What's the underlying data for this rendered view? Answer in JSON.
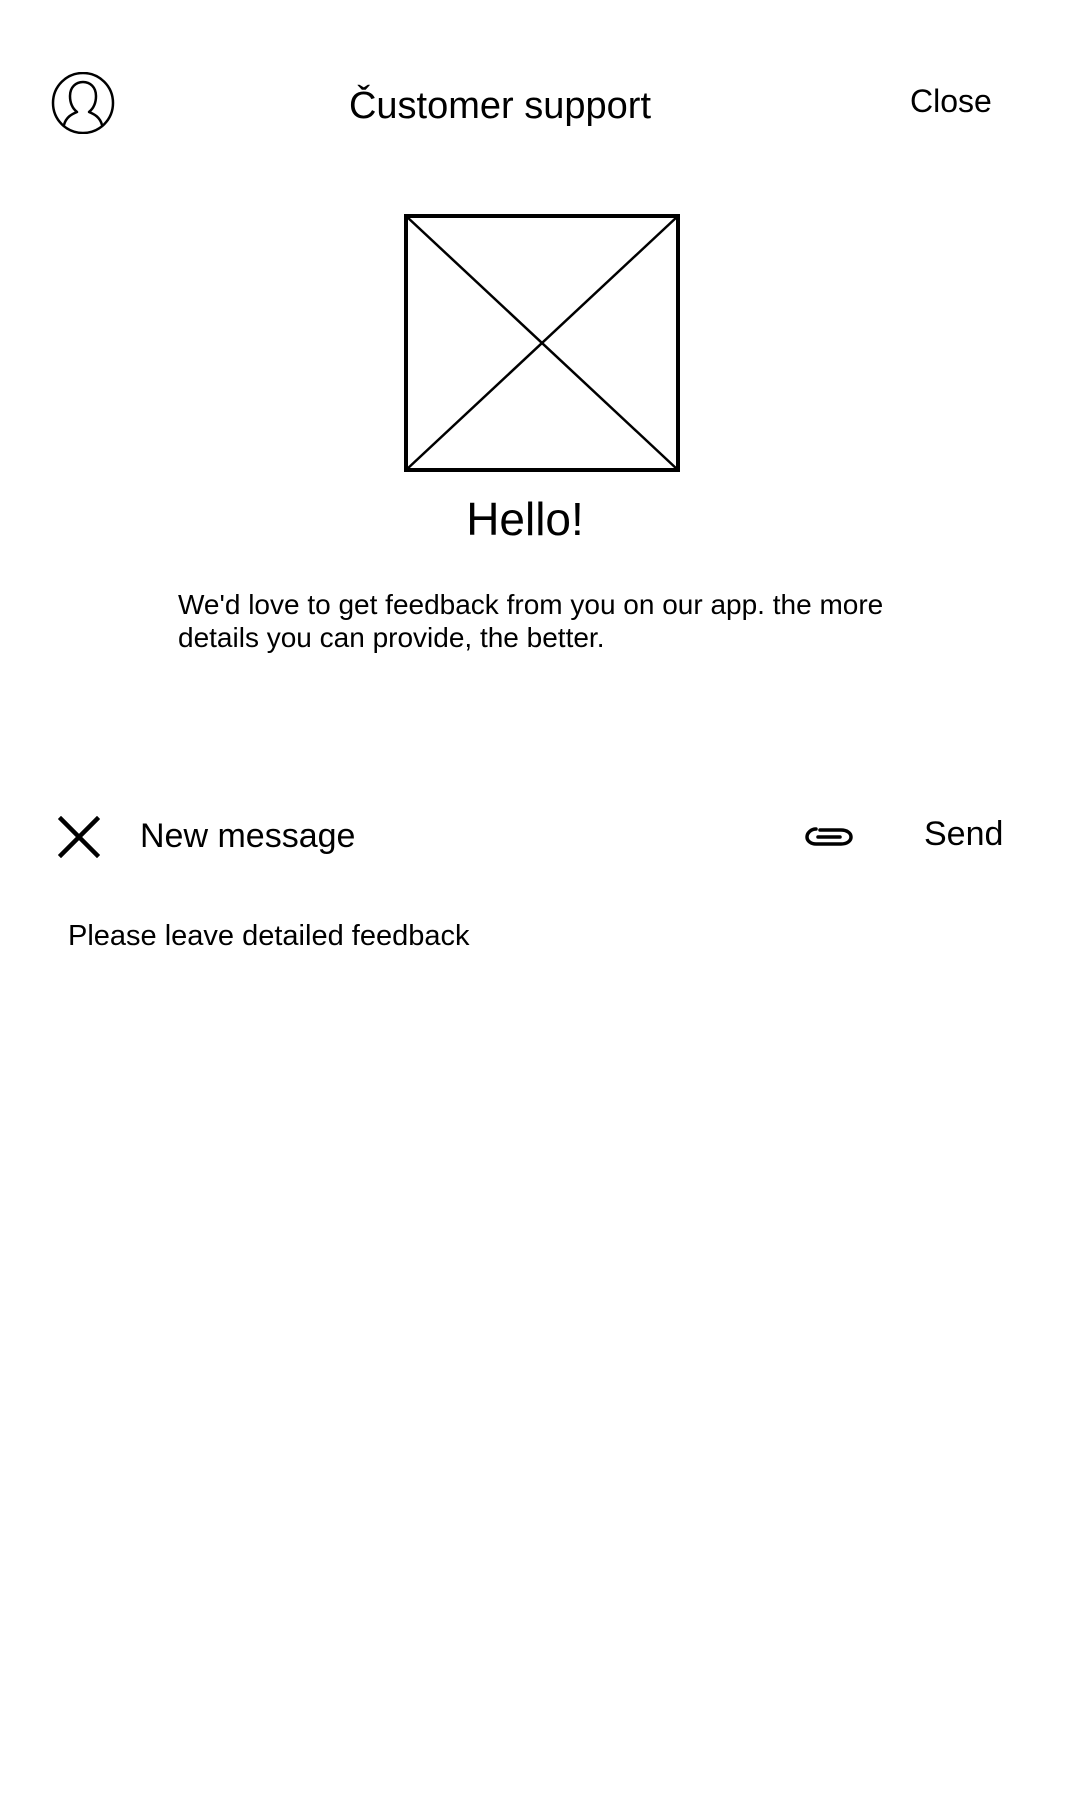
{
  "header": {
    "title": "Čustomer support",
    "close_label": "Close",
    "avatar_icon": "user-avatar-icon"
  },
  "hero": {
    "image_icon": "image-placeholder-icon",
    "heading": "Hello!",
    "body": "We'd love to get feedback from you on our app. the more details you can provide, the better."
  },
  "composer": {
    "close_icon": "close-x-icon",
    "title": "New message",
    "attach_icon": "paperclip-icon",
    "send_label": "Send",
    "message_placeholder": "Please leave detailed feedback",
    "message_value": ""
  }
}
